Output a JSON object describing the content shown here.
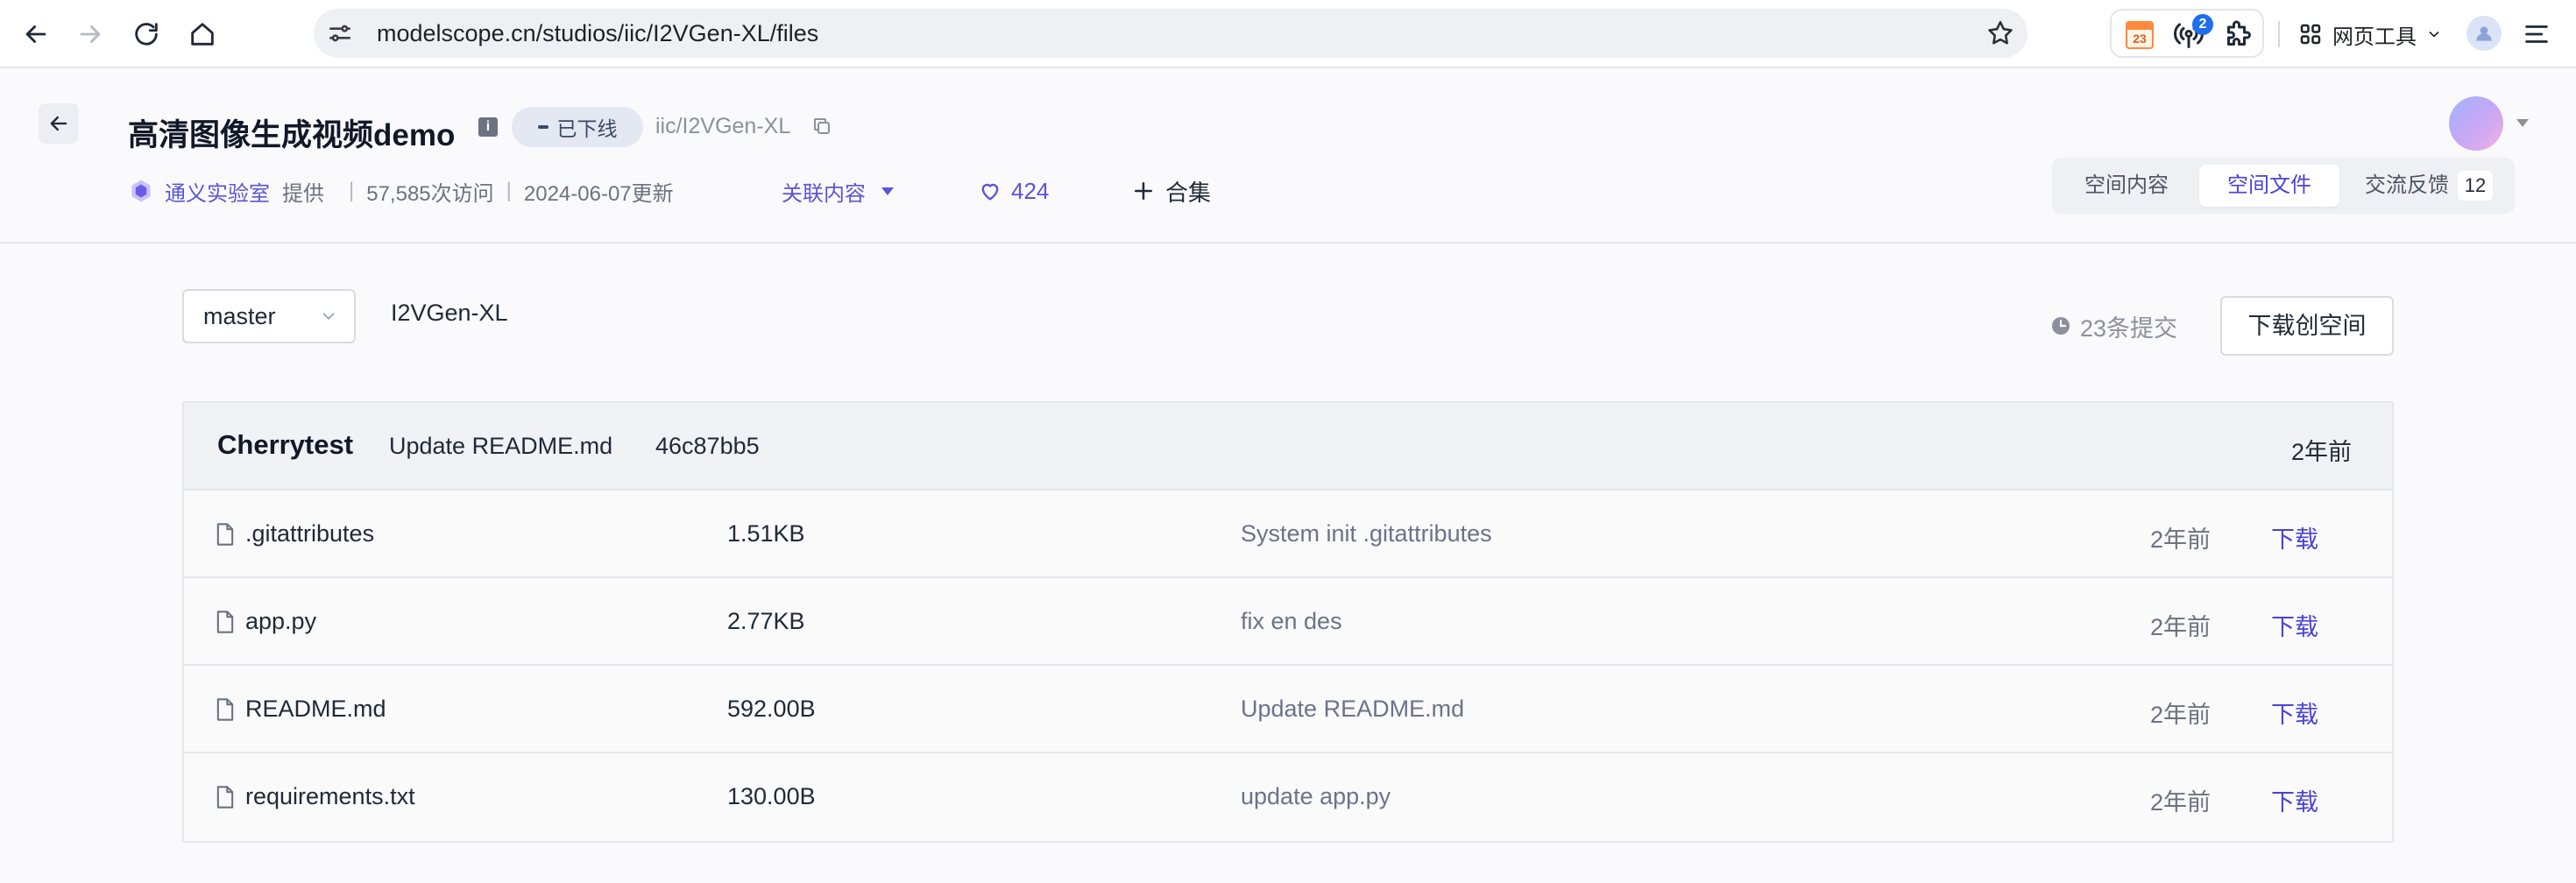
{
  "browser": {
    "url": "modelscope.cn/studios/iic/I2VGen-XL/files",
    "calendar_day": "23",
    "notification_count": "2",
    "tools_label": "网页工具"
  },
  "header": {
    "title": "高清图像生成视频demo",
    "status": "已下线",
    "repo_path": "iic/I2VGen-XL",
    "org_name": "通义实验室",
    "provided": "提供",
    "visits": "57,585次访问",
    "updated": "2024-06-07更新",
    "related_label": "关联内容",
    "likes": "424",
    "collection_label": "合集"
  },
  "tabs": [
    {
      "label": "空间内容"
    },
    {
      "label": "空间文件"
    },
    {
      "label": "交流反馈",
      "count": "12"
    }
  ],
  "repo": {
    "branch": "master",
    "name": "I2VGen-XL",
    "commits": "23条提交",
    "download_label": "下载创空间"
  },
  "latest_commit": {
    "author": "Cherrytest",
    "message": "Update README.md",
    "hash": "46c87bb5",
    "time": "2年前"
  },
  "files": [
    {
      "name": ".gitattributes",
      "size": "1.51KB",
      "message": "System init .gitattributes",
      "time": "2年前",
      "action": "下载"
    },
    {
      "name": "app.py",
      "size": "2.77KB",
      "message": "fix en des",
      "time": "2年前",
      "action": "下载"
    },
    {
      "name": "README.md",
      "size": "592.00B",
      "message": "Update README.md",
      "time": "2年前",
      "action": "下载"
    },
    {
      "name": "requirements.txt",
      "size": "130.00B",
      "message": "update app.py",
      "time": "2年前",
      "action": "下载"
    }
  ],
  "colors": {
    "accent": "#4a42d8",
    "accent_link": "#5b54d6",
    "badge_blue": "#1f6feb",
    "page_bg": "#fafafc"
  }
}
